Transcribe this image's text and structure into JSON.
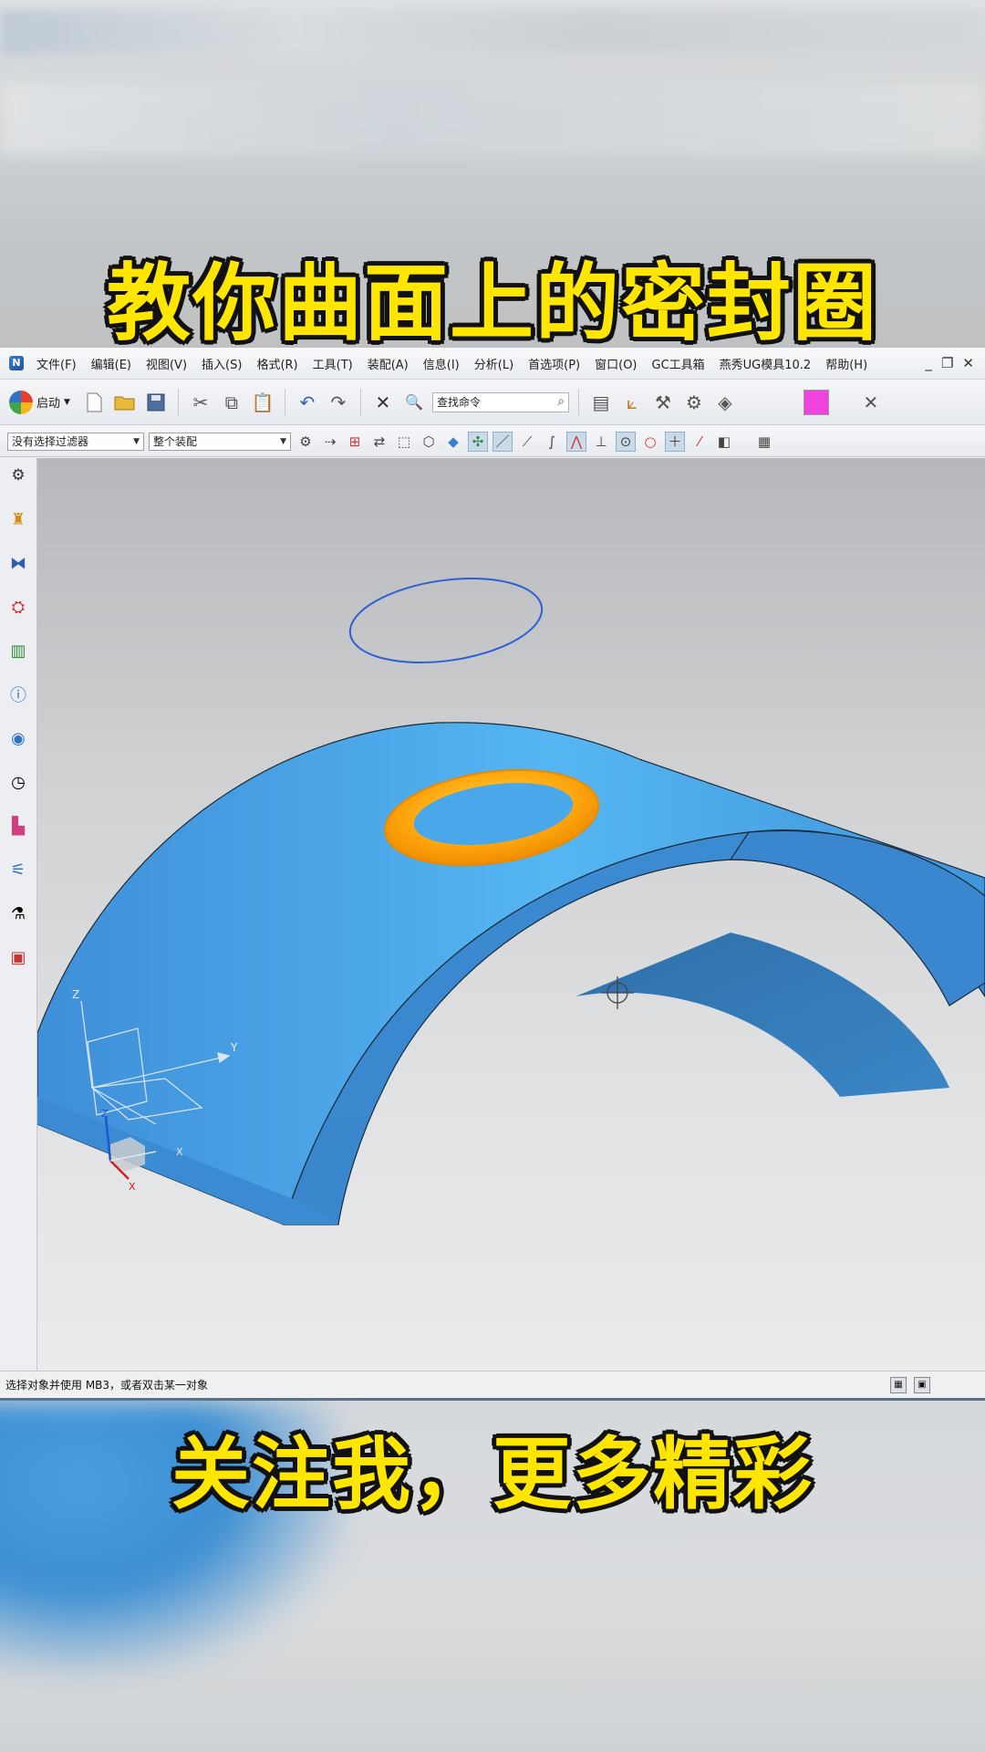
{
  "captions": {
    "top": "教你曲面上的密封圈",
    "bottom": "关注我，更多精彩"
  },
  "menu": {
    "items": [
      "文件(F)",
      "编辑(E)",
      "视图(V)",
      "插入(S)",
      "格式(R)",
      "工具(T)",
      "装配(A)",
      "信息(I)",
      "分析(L)",
      "首选项(P)",
      "窗口(O)",
      "GC工具箱",
      "燕秀UG模具10.2",
      "帮助(H)"
    ],
    "window_controls": [
      "_",
      "❐",
      "✕"
    ]
  },
  "toolbar": {
    "start_label": "启动",
    "search_placeholder": "查找命令",
    "color_swatch": "#ee44dd"
  },
  "selection_bar": {
    "filter_value": "没有选择过滤器",
    "scope_value": "整个装配"
  },
  "viewport": {
    "csys_labels": {
      "z": "Z",
      "y": "Y",
      "x": "X"
    },
    "model_colors": {
      "body": "#3d8fd6",
      "seal_ring": "#ffa500",
      "circle": "#2e5fd6"
    }
  },
  "status": {
    "text": "选择对象并使用 MB3，或者双击某一对象"
  }
}
